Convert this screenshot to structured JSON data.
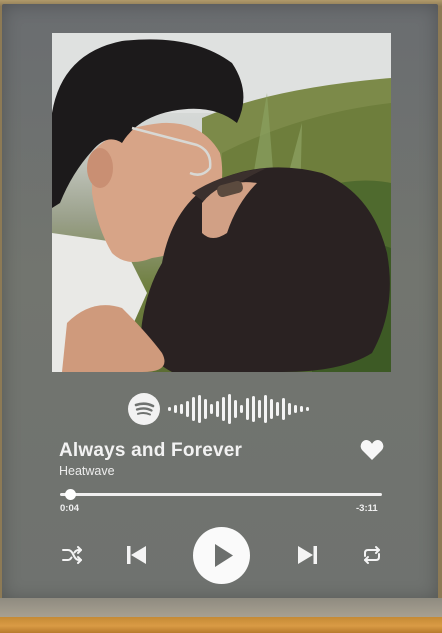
{
  "player": {
    "track_title": "Always and Forever",
    "artist": "Heatwave",
    "time_elapsed": "0:04",
    "time_remaining": "-3:11",
    "progress_fraction": 0.03,
    "liked": true
  },
  "icons": {
    "logo": "spotify-logo-icon",
    "code": "spotify-soundwave-code",
    "like": "heart-icon",
    "shuffle": "shuffle-icon",
    "previous": "skip-previous-icon",
    "play": "play-icon",
    "next": "skip-next-icon",
    "repeat": "repeat-icon"
  },
  "colors": {
    "panel": "#6f7270",
    "text": "#f2f2f2",
    "frame_wood": "#d99b45"
  }
}
